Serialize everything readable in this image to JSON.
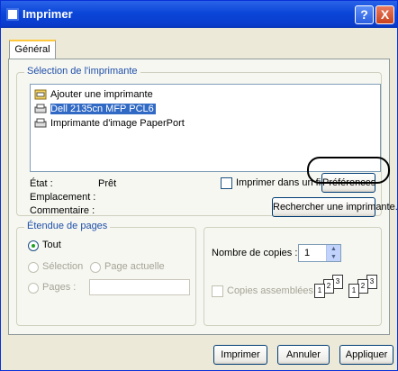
{
  "window": {
    "title": "Imprimer",
    "help_label": "?",
    "close_label": "X"
  },
  "tabs": [
    {
      "label": "Général",
      "selected": true
    }
  ],
  "printer_selection": {
    "group_label": "Sélection de l'imprimante",
    "printers": [
      {
        "label": "Ajouter une imprimante",
        "icon": "add-printer-icon"
      },
      {
        "label": "Dell 2135cn MFP PCL6",
        "icon": "printer-icon",
        "selected": true
      },
      {
        "label": "Imprimante d'image PaperPort",
        "icon": "printer-icon"
      }
    ],
    "status_label": "État :",
    "status_value": "Prêt",
    "location_label": "Emplacement :",
    "comment_label": "Commentaire :",
    "print_to_file_label": "Imprimer dans un fichi",
    "preferences_button": "Préférences",
    "find_printer_button": "Rechercher une imprimante..."
  },
  "page_range": {
    "group_label": "Étendue de pages",
    "all_label": "Tout",
    "selection_label": "Sélection",
    "current_page_label": "Page actuelle",
    "pages_label": "Pages :",
    "pages_value": ""
  },
  "copies": {
    "count_label": "Nombre de copies :",
    "count_value": "1",
    "collate_label": "Copies assemblées",
    "collate_pages": [
      "1",
      "2",
      "3"
    ]
  },
  "buttons": {
    "print": "Imprimer",
    "cancel": "Annuler",
    "apply": "Appliquer"
  },
  "colors": {
    "titlebar": "#0a46d8",
    "selection": "#316ac5",
    "group_label": "#1e4fa8"
  }
}
